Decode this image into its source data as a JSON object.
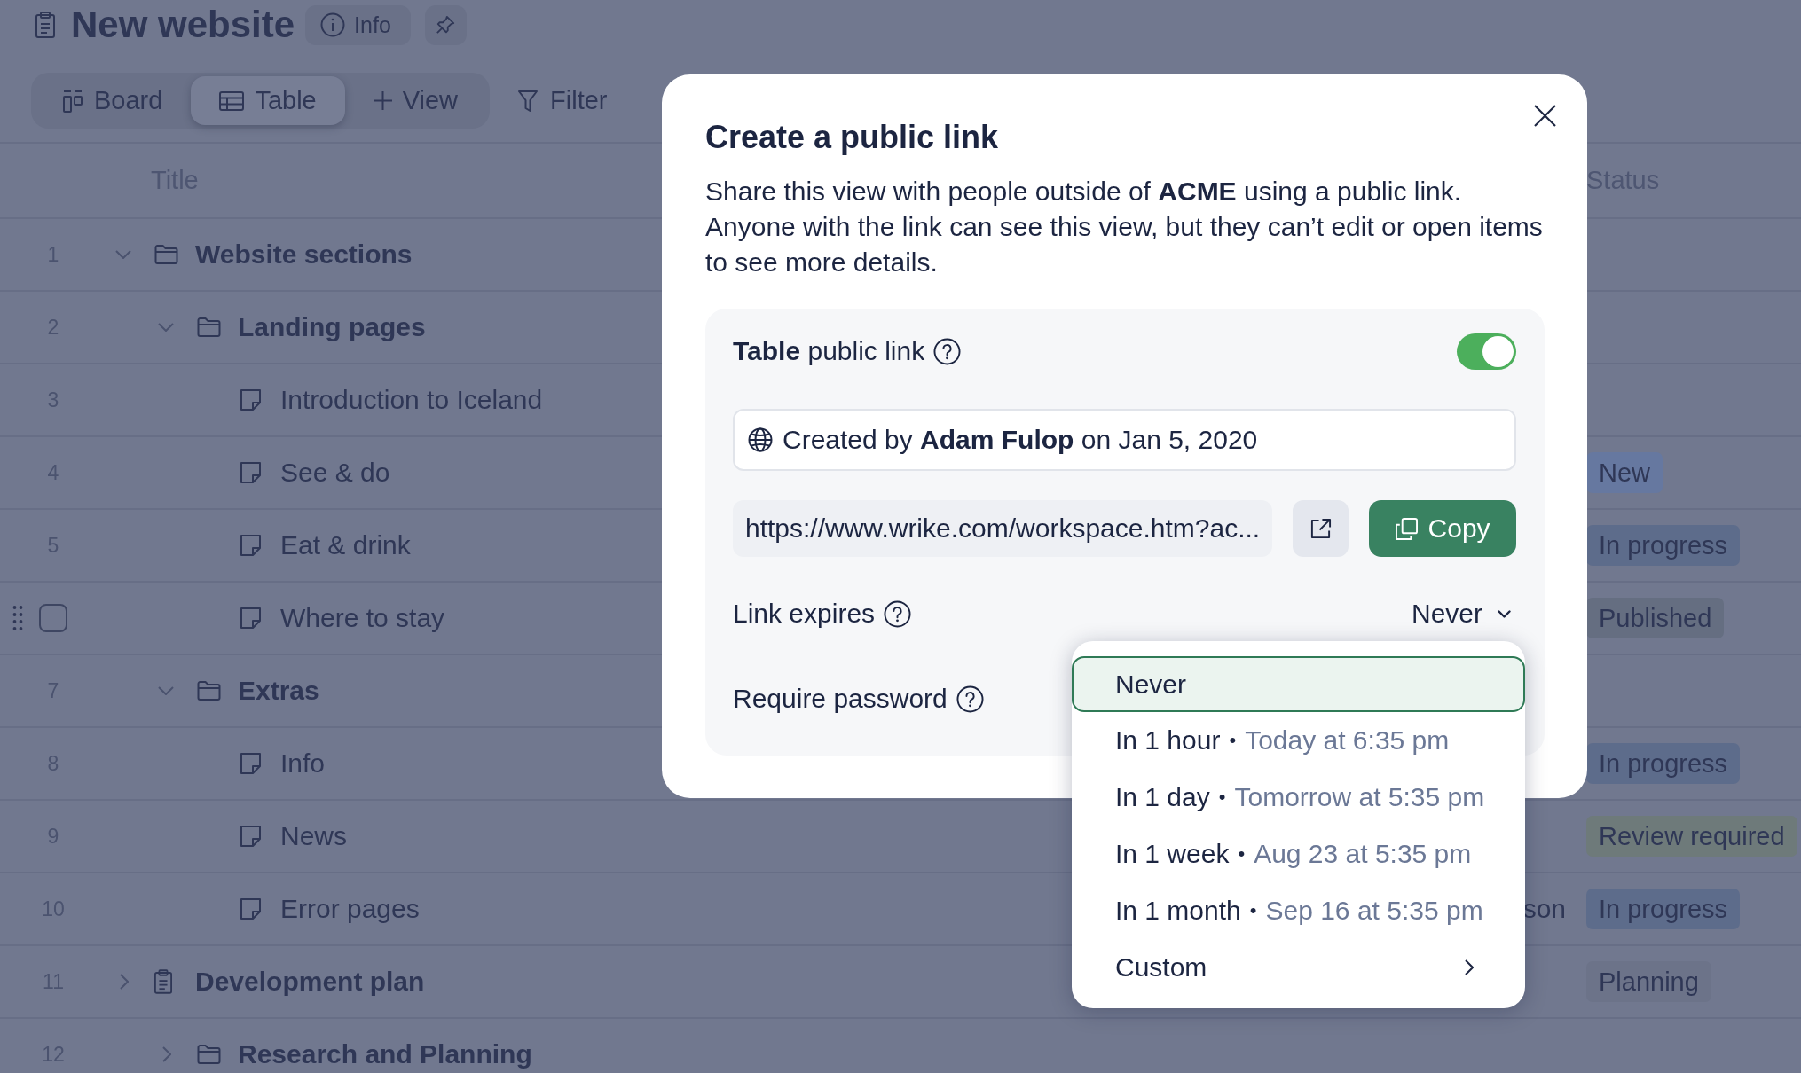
{
  "header": {
    "title": "New website",
    "info_button": "Info"
  },
  "view_tabs": [
    {
      "kind": "board",
      "label": "Board",
      "selected": false
    },
    {
      "kind": "table",
      "label": "Table",
      "selected": true
    },
    {
      "kind": "add",
      "label": "View",
      "selected": false
    }
  ],
  "filter_button": "Filter",
  "table": {
    "columns": [
      "Title",
      "Status"
    ],
    "rows": [
      {
        "number": "1",
        "title": "Website sections",
        "kind": "folder",
        "expanded": true,
        "hovered": false,
        "children": [
          {
            "number": "2",
            "title": "Landing pages",
            "kind": "folder",
            "expanded": true,
            "hovered": false,
            "children": [
              {
                "number": "3",
                "title": "Introduction to Iceland",
                "kind": "task",
                "hovered": false
              },
              {
                "number": "4",
                "title": "See & do",
                "kind": "task",
                "hovered": false,
                "status": {
                  "label": "New",
                  "color": "#6678a0"
                }
              },
              {
                "number": "5",
                "title": "Eat & drink",
                "kind": "task",
                "hovered": false,
                "status": {
                  "label": "In progress",
                  "color": "#5d6c8b"
                }
              },
              {
                "title": "Where to stay",
                "kind": "task",
                "hovered": true,
                "checked": false,
                "status": {
                  "label": "Published",
                  "color": "#656e81"
                }
              }
            ]
          },
          {
            "number": "7",
            "title": "Extras",
            "kind": "folder",
            "expanded": true,
            "hovered": false,
            "children": [
              {
                "number": "8",
                "title": "Info",
                "kind": "task",
                "hovered": false,
                "status": {
                  "label": "In progress",
                  "color": "#5d6c8b"
                }
              },
              {
                "number": "9",
                "title": "News",
                "kind": "task",
                "hovered": false,
                "status": {
                  "label": "Review required",
                  "color": "#6e7a7a"
                }
              },
              {
                "number": "10",
                "title": "Error pages",
                "kind": "task",
                "hovered": false,
                "column_2": "son",
                "status": {
                  "label": "In progress",
                  "color": "#5d6c8b"
                }
              }
            ]
          }
        ]
      },
      {
        "number": "11",
        "title": "Development plan",
        "kind": "project",
        "expanded": false,
        "hovered": false,
        "status": {
          "label": "Planning",
          "color": "#6c7389"
        },
        "children": [
          {
            "number": "12",
            "title": "Research and Planning",
            "kind": "folder",
            "expanded": false,
            "hovered": false
          }
        ]
      }
    ]
  },
  "dialog": {
    "title": "Create a public link",
    "description": "Share this view with people outside of **ACME** using a public link. Anyone with the link can see this view, but they can’t edit or open items to see more details.",
    "link_panel": {
      "label": "**Table** public link",
      "enabled": true,
      "created_by": "Created by **Adam Fulop** on Jan 5, 2020",
      "url": "https://www.wrike.com/workspace.htm?ac...",
      "copy_button": "Copy"
    },
    "link_expires": {
      "label": "Link expires",
      "value": "Never"
    },
    "require_password": {
      "label": "Require password"
    },
    "expiry_menu": [
      {
        "kind": "option",
        "label": "Never",
        "selected": true
      },
      {
        "kind": "option",
        "label": "In 1 hour",
        "separator": "•",
        "detail": "Today at 6:35 pm",
        "selected": false
      },
      {
        "kind": "option",
        "label": "In 1 day",
        "separator": "•",
        "detail": "Tomorrow at 5:35 pm",
        "selected": false
      },
      {
        "kind": "option",
        "label": "In 1 week",
        "separator": "•",
        "detail": "Aug 23 at 5:35 pm",
        "selected": false
      },
      {
        "kind": "option",
        "label": "In 1 month",
        "separator": "•",
        "detail": "Sep 16 at 5:35 pm",
        "selected": false
      },
      {
        "kind": "submenu",
        "label": "Custom",
        "selected": false
      }
    ]
  }
}
